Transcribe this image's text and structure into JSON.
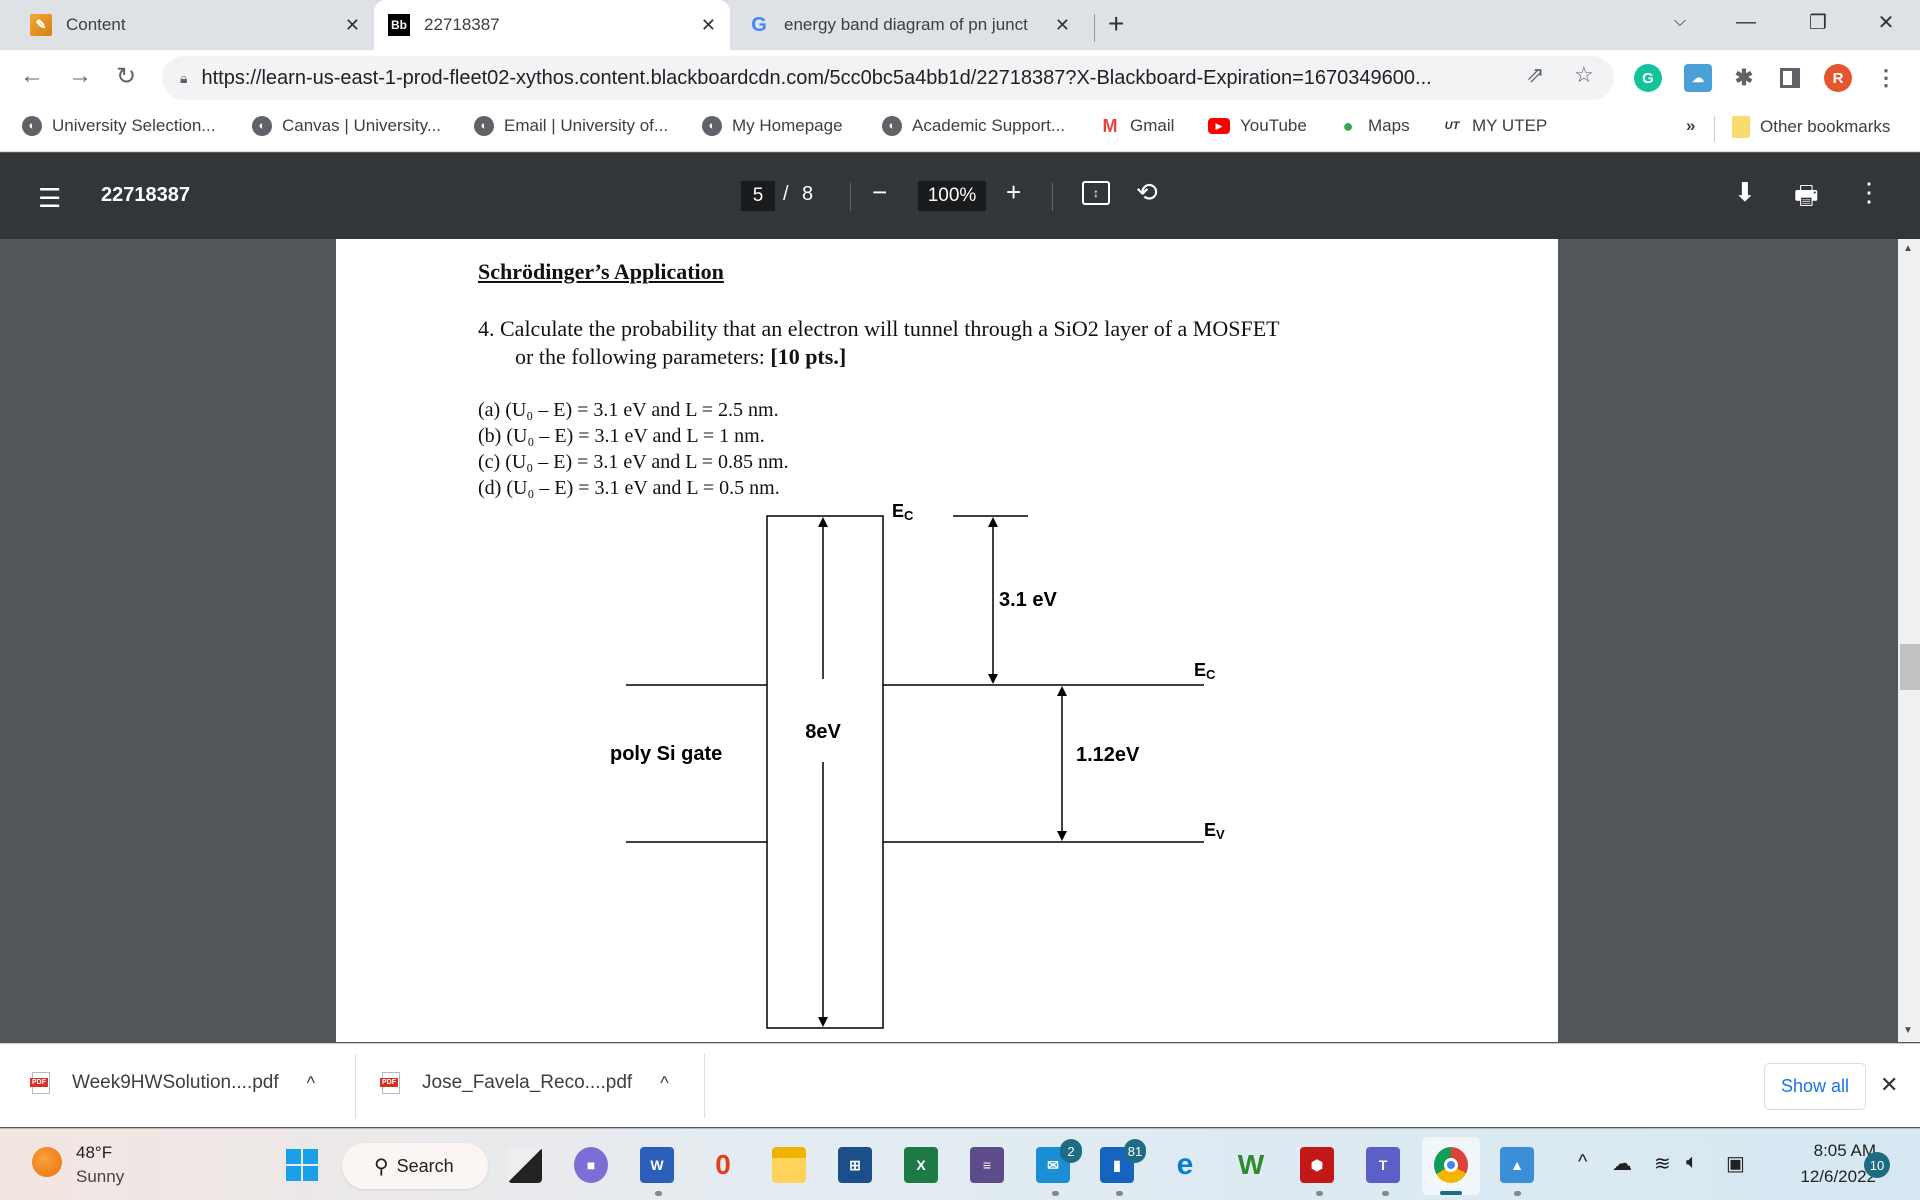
{
  "browser": {
    "tabs": [
      {
        "title": "Content",
        "favicon": "pencil-icon",
        "active": false
      },
      {
        "title": "22718387",
        "favicon": "Bb",
        "active": true
      },
      {
        "title": "energy band diagram of pn junct",
        "favicon": "G",
        "active": false
      }
    ],
    "new_tab_label": "+",
    "url": "https://learn-us-east-1-prod-fleet02-xythos.content.blackboardcdn.com/5cc0bc5a4bb1d/22718387?X-Blackboard-Expiration=1670349600...",
    "profile_initial": "R",
    "bookmarks": [
      {
        "label": "University Selection..."
      },
      {
        "label": "Canvas | University..."
      },
      {
        "label": "Email | University of..."
      },
      {
        "label": "My Homepage"
      },
      {
        "label": "Academic Support..."
      },
      {
        "label": "Gmail"
      },
      {
        "label": "YouTube"
      },
      {
        "label": "Maps"
      },
      {
        "label": "MY UTEP"
      }
    ],
    "bookmarks_overflow": "»",
    "other_bookmarks": "Other bookmarks"
  },
  "pdf_viewer": {
    "document_title": "22718387",
    "current_page": "5",
    "page_separator": "/",
    "total_pages": "8",
    "zoom": "100%"
  },
  "document": {
    "heading": "Schrödinger’s Application",
    "question_line1": "4.  Calculate the probability that an electron will tunnel through a SiO2 layer of a MOSFET",
    "question_line2_prefix": "or the following parameters: ",
    "question_points": "[10 pts.]",
    "parameters": [
      "(a)  (U₀ – E) = 3.1 eV and L = 2.5 nm.",
      "(b)  (U₀ – E) = 3.1 eV and L = 1 nm.",
      "(c)  (U₀ – E) = 3.1 eV and L = 0.85 nm.",
      "(d)  (U₀ – E) = 3.1 eV and L = 0.5 nm."
    ],
    "diagram": {
      "oxide_bandgap_label": "8eV",
      "barrier_label": "3.1 eV",
      "si_bandgap_label": "1.12eV",
      "gate_label": "poly Si gate",
      "ec_oxide_label": "E",
      "ec_oxide_sub": "C",
      "ec_si_label": "E",
      "ec_si_sub": "C",
      "ev_si_label": "E",
      "ev_si_sub": "V"
    }
  },
  "downloads": {
    "items": [
      {
        "name": "Week9HWSolution....pdf"
      },
      {
        "name": "Jose_Favela_Reco....pdf"
      }
    ],
    "show_all": "Show all"
  },
  "taskbar": {
    "weather_temp": "48°F",
    "weather_desc": "Sunny",
    "search_label": "Search",
    "mail_badge": "2",
    "outlook_badge": "81",
    "time": "8:05 AM",
    "date": "12/6/2022",
    "notification_count": "10"
  }
}
